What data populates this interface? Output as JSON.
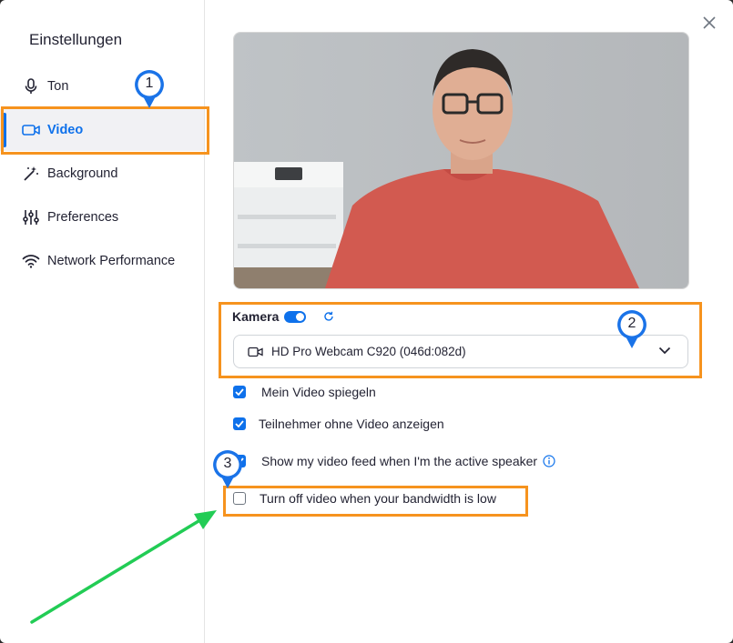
{
  "sidebar": {
    "title": "Einstellungen",
    "items": [
      {
        "label": "Ton"
      },
      {
        "label": "Video"
      },
      {
        "label": "Background"
      },
      {
        "label": "Preferences"
      },
      {
        "label": "Network Performance"
      }
    ]
  },
  "camera": {
    "label": "Kamera",
    "selected": "HD Pro Webcam C920 (046d:082d)"
  },
  "options": [
    {
      "label": "Mein Video spiegeln",
      "checked": true
    },
    {
      "label": "Teilnehmer ohne Video anzeigen",
      "checked": true
    },
    {
      "label": "Show my video feed when I'm the active speaker",
      "checked": true
    },
    {
      "label": "Turn off video when your bandwidth is low",
      "checked": false
    }
  ],
  "annotations": {
    "markers": [
      "1",
      "2",
      "3"
    ],
    "highlight_color": "#f6931e",
    "pin_color": "#1a73e8",
    "arrow_color": "#22cc55"
  },
  "colors": {
    "accent": "#0e71eb"
  }
}
